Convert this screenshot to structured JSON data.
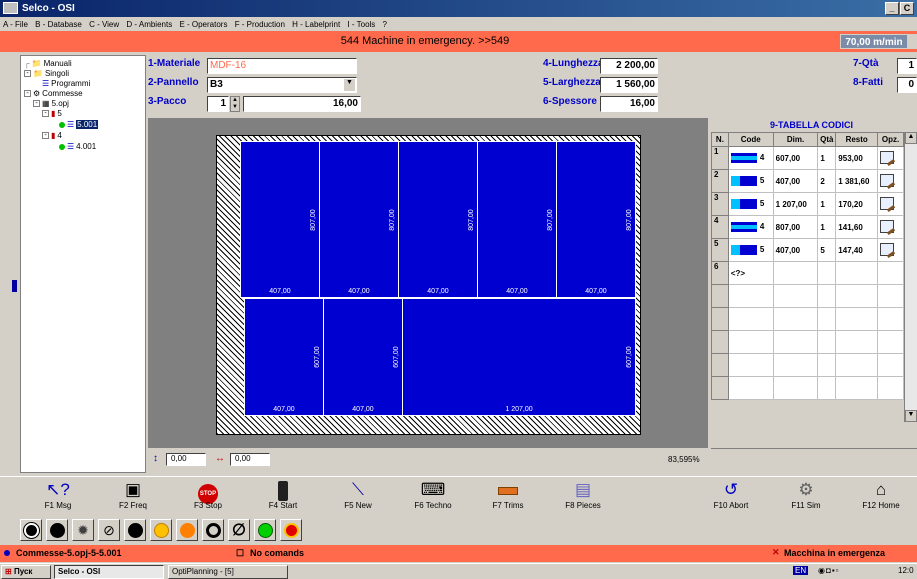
{
  "window": {
    "title": "Selco - OSI",
    "min": "_",
    "max": "С",
    "close": "×"
  },
  "menu": [
    "A - File",
    "B - Database",
    "C - View",
    "D - Ambients",
    "E - Operators",
    "F - Production",
    "H - Labelprint",
    "I - Tools",
    "?"
  ],
  "message": "544 Machine in emergency. >>549",
  "speed": "70,00 m/min",
  "tree": {
    "manuali": "Manuali",
    "singoli": "Singoli",
    "programmi": "Programmi",
    "commesse": "Commesse",
    "file": "5.opj",
    "n5": "5",
    "item5": "5.001",
    "n4": "4",
    "item4": "4.001"
  },
  "form": {
    "materiale_label": "1-Materiale",
    "materiale_value": "MDF-16",
    "pannello_label": "2-Pannello",
    "pannello_value": "B3",
    "pacco_label": "3-Pacco",
    "pacco_value": "1",
    "pacco_thick": "16,00",
    "lunghezza_label": "4-Lunghezza",
    "lunghezza_value": "2 200,00",
    "larghezza_label": "5-Larghezza",
    "larghezza_value": "1 560,00",
    "spessore_label": "6-Spessore",
    "spessore_value": "16,00",
    "qta_label": "7-Qtà",
    "qta_value": "1",
    "fatti_label": "8-Fatti",
    "fatti_value": "0"
  },
  "layout_pieces": {
    "top_widths": [
      "407,00",
      "407,00",
      "407,00",
      "407,00",
      "407,00"
    ],
    "top_height": "807,00",
    "bottom": [
      {
        "w": "407,00",
        "h": "607,00"
      },
      {
        "w": "407,00",
        "h": "607,00"
      },
      {
        "w": "1 207,00",
        "h": "607,00"
      }
    ]
  },
  "bottombar": {
    "x_value": "0,00",
    "y_value": "0,00",
    "zoom": "83,595%"
  },
  "codetable": {
    "title": "9-TABELLA CODICI",
    "headers": [
      "N.",
      "Code",
      "Dim.",
      "Qtà",
      "Resto",
      "Opz."
    ],
    "rows": [
      {
        "n": "1",
        "code": "4",
        "dim": "607,00",
        "qta": "1",
        "resto": "953,00"
      },
      {
        "n": "2",
        "code": "5",
        "dim": "407,00",
        "qta": "2",
        "resto": "1 381,60"
      },
      {
        "n": "3",
        "code": "5",
        "dim": "1 207,00",
        "qta": "1",
        "resto": "170,20"
      },
      {
        "n": "4",
        "code": "4",
        "dim": "807,00",
        "qta": "1",
        "resto": "141,60"
      },
      {
        "n": "5",
        "code": "5",
        "dim": "407,00",
        "qta": "5",
        "resto": "147,40"
      },
      {
        "n": "6",
        "code": "<?>",
        "dim": "",
        "qta": "",
        "resto": ""
      }
    ]
  },
  "fkeys": [
    {
      "label": "F1 Msg",
      "icon": "help-cursor-icon"
    },
    {
      "label": "F2 Freq",
      "icon": "camera-icon"
    },
    {
      "label": "F3 Stop",
      "icon": "stop-sign-icon"
    },
    {
      "label": "F4 Start",
      "icon": "traffic-light-icon"
    },
    {
      "label": "F5 New",
      "icon": "magic-wand-icon"
    },
    {
      "label": "F6 Techno",
      "icon": "machine-icon"
    },
    {
      "label": "F7 Trims",
      "icon": "trim-icon"
    },
    {
      "label": "F8 Pieces",
      "icon": "pieces-icon"
    },
    {
      "label": "F10 Abort",
      "icon": "undo-icon"
    },
    {
      "label": "F11 Sim",
      "icon": "simulation-icon"
    },
    {
      "label": "F12 Home",
      "icon": "home-icon"
    }
  ],
  "status": {
    "left": "Commesse-5.opj-5-5.001",
    "middle": "No comands",
    "right": "Macchina in emergenza"
  },
  "taskbar": {
    "start": "Пуск",
    "task1": "Selco - OSI",
    "task2": "OptiPlanning - [5]",
    "lang": "EN",
    "clock": "12:0"
  },
  "colors": {
    "piece": "#0000d0",
    "alarm": "#ff6a4d",
    "label": "#0000c8"
  }
}
